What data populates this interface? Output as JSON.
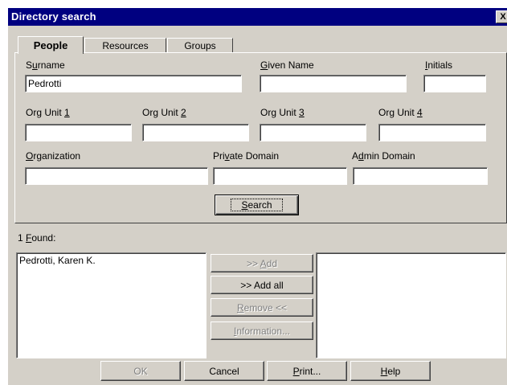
{
  "window": {
    "title": "Directory search",
    "close_label": "X"
  },
  "tabs": [
    {
      "label": "People",
      "active": true
    },
    {
      "label": "Resources",
      "active": false
    },
    {
      "label": "Groups",
      "active": false
    }
  ],
  "form": {
    "surname": {
      "label": "Surname",
      "value": "Pedrotti"
    },
    "given_name": {
      "label": "Given Name",
      "value": ""
    },
    "initials": {
      "label": "Initials",
      "value": ""
    },
    "org_unit_1": {
      "label": "Org Unit 1",
      "value": ""
    },
    "org_unit_2": {
      "label": "Org Unit 2",
      "value": ""
    },
    "org_unit_3": {
      "label": "Org Unit 3",
      "value": ""
    },
    "org_unit_4": {
      "label": "Org Unit 4",
      "value": ""
    },
    "organization": {
      "label": "Organization",
      "value": ""
    },
    "private_domain": {
      "label": "Private Domain",
      "value": ""
    },
    "admin_domain": {
      "label": "Admin Domain",
      "value": ""
    },
    "search_button": "Search"
  },
  "results": {
    "found_count": "1",
    "found_label": "Found:",
    "items": [
      "Pedrotti, Karen K."
    ],
    "selected_items": []
  },
  "transfer_buttons": {
    "add": ">> Add",
    "add_all": ">> Add all",
    "remove": "Remove <<",
    "information": "Information..."
  },
  "footer_buttons": {
    "ok": "OK",
    "cancel": "Cancel",
    "print": "Print...",
    "help": "Help"
  }
}
